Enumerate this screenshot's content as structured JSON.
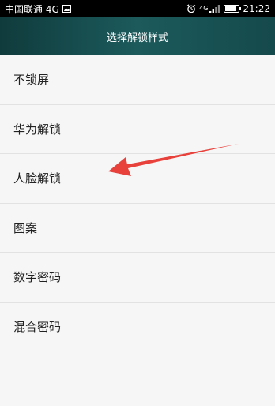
{
  "status_bar": {
    "carrier": "中国联通 4G",
    "network_label": "4G",
    "time": "21:22",
    "battery_level": 0.85
  },
  "header": {
    "title": "选择解锁样式"
  },
  "options": [
    {
      "label": "不锁屏"
    },
    {
      "label": "华为解锁"
    },
    {
      "label": "人脸解锁"
    },
    {
      "label": "图案"
    },
    {
      "label": "数字密码"
    },
    {
      "label": "混合密码"
    }
  ],
  "annotation": {
    "type": "arrow",
    "color": "#e8403a",
    "points_to": "人脸解锁"
  }
}
